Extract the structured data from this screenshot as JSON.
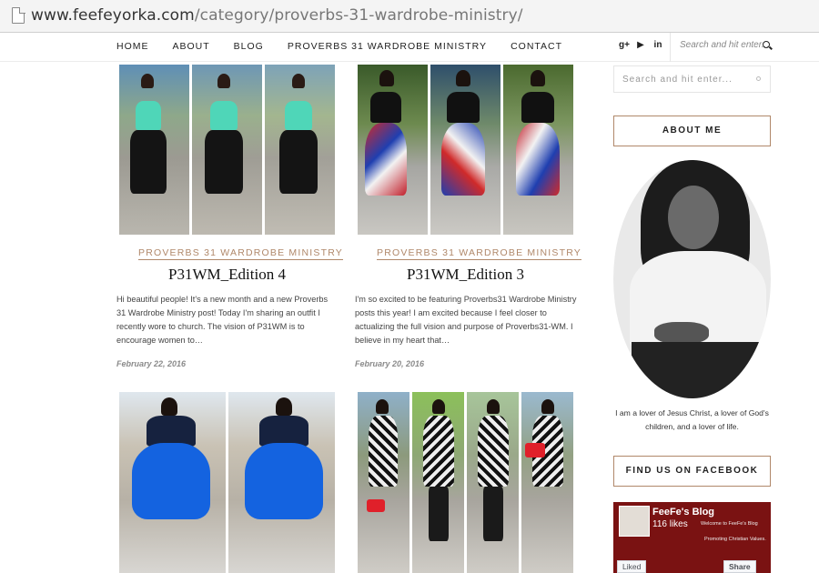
{
  "browser": {
    "url_host": "www.feefeyorka.com",
    "url_path": "/category/proverbs-31-wardrobe-ministry/"
  },
  "nav": {
    "items": [
      "HOME",
      "ABOUT",
      "BLOG",
      "PROVERBS 31 WARDROBE MINISTRY",
      "CONTACT"
    ],
    "social_icons": [
      "google-plus-icon",
      "youtube-icon",
      "linkedin-icon"
    ],
    "social_glyphs": [
      "g+",
      "▶",
      "in"
    ],
    "search_placeholder": "Search and hit enter..."
  },
  "posts": [
    {
      "category": "PROVERBS 31 WARDROBE MINISTRY",
      "title": "P31WM_Edition 4",
      "excerpt": "Hi beautiful people! It's a new month and a new Proverbs 31 Wardrobe Ministry post! Today I'm sharing an outfit I recently wore to church. The vision of P31WM is to encourage women to…",
      "date": "February 22, 2016"
    },
    {
      "category": "PROVERBS 31 WARDROBE MINISTRY",
      "title": "P31WM_Edition 3",
      "excerpt": "I'm so excited to be featuring Proverbs31 Wardrobe Ministry posts this year! I am excited because I feel closer to actualizing the full vision and purpose of Proverbs31-WM. I believe in my heart that…",
      "date": "February 20, 2016"
    }
  ],
  "sidebar": {
    "search_placeholder": "Search and hit enter...",
    "about_title": "ABOUT ME",
    "about_text": "I am a lover of Jesus Christ, a lover of God's children, and a lover of life.",
    "facebook_title": "FIND US ON FACEBOOK",
    "facebook": {
      "page_name": "FeeFe's Blog",
      "likes": "116 likes",
      "cover_line1": "Welcome to FeeFe's Blog",
      "cover_line2": "Promoting Christian Values.",
      "liked_label": "Liked",
      "share_label": "Share"
    }
  },
  "colors": {
    "accent": "#b0886a",
    "text": "#222222",
    "facebook_cover": "#7a1212"
  }
}
